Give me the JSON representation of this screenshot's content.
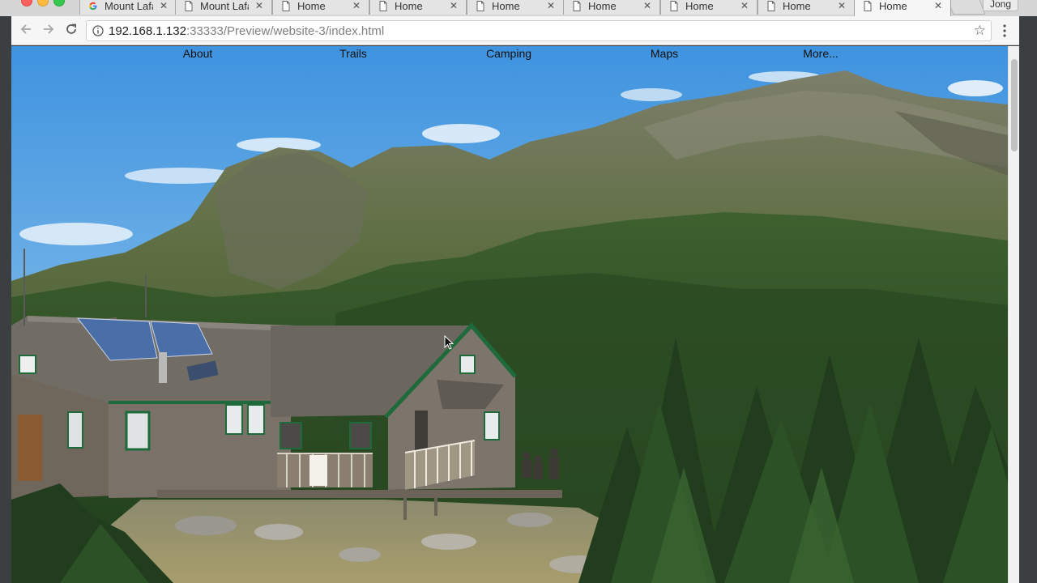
{
  "browser": {
    "tabs": [
      {
        "title": "Mount Lafa",
        "favicon": "google-g-icon"
      },
      {
        "title": "Mount Lafa",
        "favicon": "page-icon"
      },
      {
        "title": "Home",
        "favicon": "page-icon"
      },
      {
        "title": "Home",
        "favicon": "page-icon"
      },
      {
        "title": "Home",
        "favicon": "page-icon"
      },
      {
        "title": "Home",
        "favicon": "page-icon"
      },
      {
        "title": "Home",
        "favicon": "page-icon"
      },
      {
        "title": "Home",
        "favicon": "page-icon"
      },
      {
        "title": "Home",
        "favicon": "page-icon",
        "active": true
      }
    ],
    "tab_close_glyph": "✕",
    "profile_name": "Jong",
    "address": {
      "host": "192.168.1.132",
      "path": ":33333/Preview/website-3/index.html"
    }
  },
  "site": {
    "nav": {
      "about": "About",
      "trails": "Trails",
      "camping": "Camping",
      "maps": "Maps",
      "more": "More..."
    },
    "hero_image": "mountain-hut-photo"
  },
  "colors": {
    "sky_top": "#4a9be0",
    "sky_bottom": "#a9d3f0",
    "mountain_far": "#6c7a5a",
    "forest_dark": "#1f3d1e",
    "forest_mid": "#2f5a2b",
    "roof": "#6f6a63",
    "hut_wall": "#7c736a",
    "trim_green": "#1f6a3a"
  }
}
